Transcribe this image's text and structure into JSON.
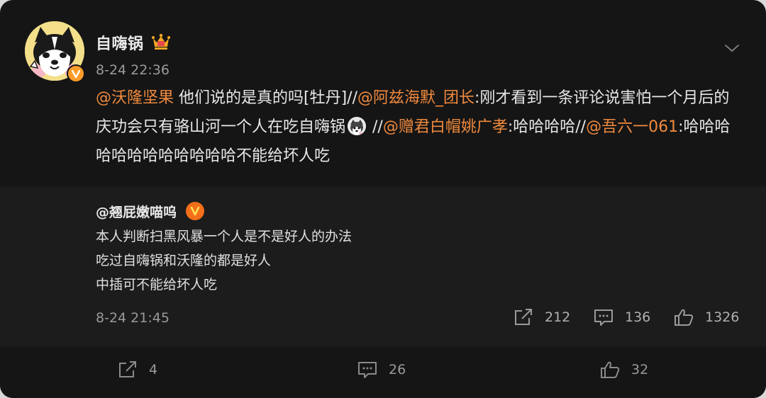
{
  "post": {
    "username": "自嗨锅",
    "timestamp": "8-24 22:36",
    "icons": {
      "avatar": "husky-dog-avatar",
      "verified": "verified-v-badge",
      "vip": "crown-icon",
      "menu": "chevron-down-icon"
    },
    "text": {
      "m1": "@沃隆坚果",
      "t1": " 他们说的是真的吗[牡丹]//",
      "m2": "@阿兹海默_团长",
      "t2": ":刚才看到一条评论说害怕一个月后的庆功会只有骆山河一个人在吃自嗨锅",
      "t3": " //",
      "m3": "@赠君白帽姚广孝",
      "t4": ":哈哈哈哈//",
      "m4": "@吾六一061",
      "t5": ":哈哈哈哈哈哈哈哈哈哈哈哈不能给坏人吃"
    }
  },
  "quote": {
    "username": "@翘屁嫩喵呜",
    "lines": [
      "本人判断扫黑风暴一个人是不是好人的办法",
      "吃过自嗨锅和沃隆的都是好人",
      "中插可不能给坏人吃"
    ],
    "timestamp": "8-24 21:45",
    "reposts": "212",
    "comments": "136",
    "likes": "1326"
  },
  "footer": {
    "reposts": "4",
    "comments": "26",
    "likes": "32"
  },
  "colors": {
    "background": "#151515",
    "quote_bg": "#1c1c1c",
    "mention": "#f08a3e",
    "text": "#e8e8e8",
    "muted": "#9a9a9a"
  }
}
